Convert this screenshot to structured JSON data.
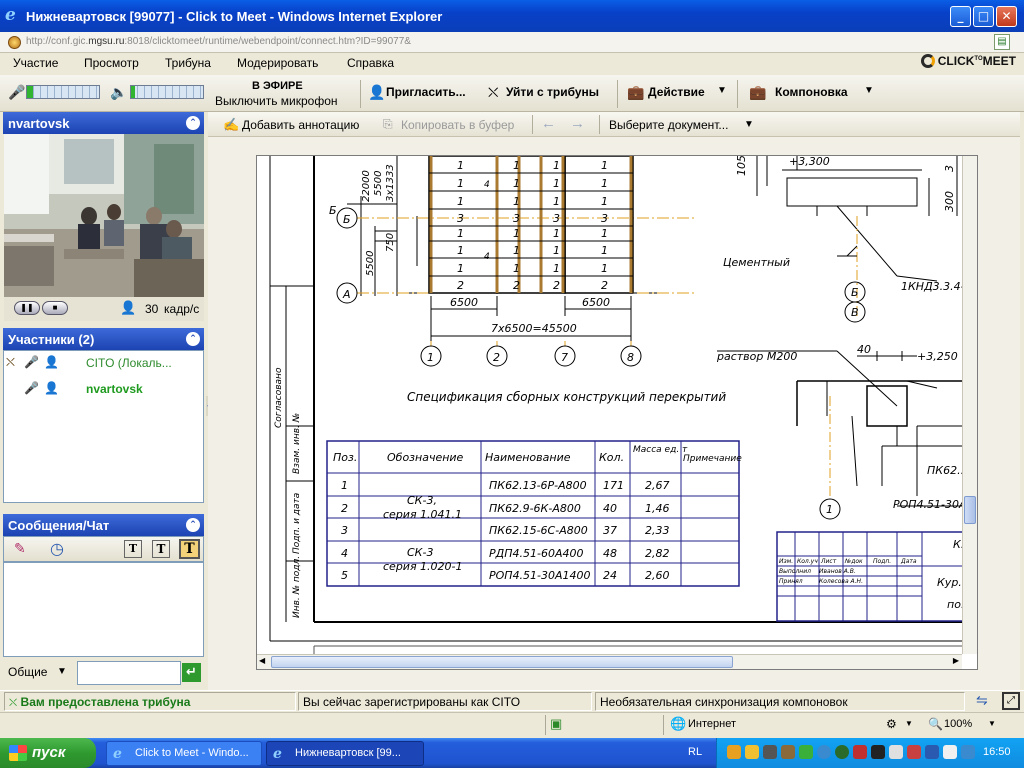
{
  "window": {
    "title": "Нижневартовск [99077] - Click to Meet - Windows Internet Explorer",
    "url_prefix": "http://conf.gic.",
    "url_domain": "mgsu.ru",
    "url_rest": ":8018/clicktomeet/runtime/webendpoint/connect.htm?ID=99077&"
  },
  "menu": [
    "Участие",
    "Просмотр",
    "Трибуна",
    "Модерировать",
    "Справка"
  ],
  "logo": {
    "text": "CLICK",
    "sup": "TO",
    "text2": "MEET"
  },
  "toolbar": {
    "on_air": "В ЭФИРЕ",
    "mic_off": "Выключить микрофон",
    "invite": "Пригласить...",
    "leave_tribune": "Уйти с трибуны",
    "action": "Действие",
    "layout": "Компоновка",
    "mic_level": 0.08,
    "speaker_level": 0.06
  },
  "video_panel": {
    "title": "nvartovsk",
    "fps_value": "30",
    "fps_unit": "кадр/с"
  },
  "participants_panel": {
    "title": "Участники (2)",
    "items": [
      {
        "name": "CITO (Локаль...",
        "color": "#2e8b2e"
      },
      {
        "name": "nvartovsk",
        "color": "#1e9a1e"
      }
    ]
  },
  "chat_panel": {
    "title": "Сообщения/Чат",
    "scope": "Общие"
  },
  "doc_toolbar": {
    "add_annotation": "Добавить аннотацию",
    "copy_to_buffer": "Копировать в буфер",
    "select_document": "Выберите документ..."
  },
  "drawing": {
    "dims_left": [
      "22000",
      "5500",
      "3х1333",
      "750",
      "5500"
    ],
    "axis_rows": [
      "Б",
      "А"
    ],
    "axis_cols": [
      "1",
      "2",
      "7",
      "8"
    ],
    "span1": "6500",
    "span2": "6500",
    "span_total": "7х6500=45500",
    "cell_values": [
      "1",
      "1",
      "1",
      "3",
      "1",
      "1",
      "1",
      "2"
    ],
    "mid_marks": [
      "4",
      "4"
    ],
    "right_labels": {
      "elev1": "+3,300",
      "dim1050": "1050",
      "dim300": "300",
      "dim3": "3",
      "mortar1": "Цементный",
      "mortar2": "раствор М200",
      "elev2": "+3,250",
      "dim40": "40",
      "axisB": "Б",
      "axisV": "В",
      "axis1": "1",
      "knd": "1КНД3.3.4-1",
      "pk62": "ПК62...",
      "rop": "РОП4.51-30А..."
    },
    "spec_title": "Спецификация сборных конструкций перекрытий",
    "side_stamp": [
      "Согласовано",
      "Взам. инв. №",
      "Подп. и дата",
      "Инв. № подл."
    ],
    "table": {
      "headers": [
        "Поз.",
        "Обозначение",
        "Наименование",
        "Кол.",
        "Масса ед. т",
        "Примечание"
      ],
      "rows": [
        [
          "1",
          "СК-3, серия 1.041.1",
          "ПК62.13-6Р-А800",
          "171",
          "2,67",
          ""
        ],
        [
          "2",
          "",
          "ПК62.9-6К-А800",
          "40",
          "1,46",
          ""
        ],
        [
          "3",
          "",
          "ПК62.15-6С-А800",
          "37",
          "2,33",
          ""
        ],
        [
          "4",
          "СК-3 серия 1.020-1",
          "РДП4.51-60А400",
          "48",
          "2,82",
          ""
        ],
        [
          "5",
          "",
          "РОП4.51-30А1400",
          "24",
          "2,60",
          ""
        ]
      ],
      "group1": [
        "СК-3,",
        "серия 1.041.1"
      ],
      "group2": [
        "СК-3",
        "серия 1.020-1"
      ]
    },
    "titleblock": {
      "headers": [
        "Изм.",
        "Кол.уч",
        "Лист",
        "№док",
        "Подп.",
        "Дата"
      ],
      "rows": [
        [
          "Выполнил",
          "Иванов А.В."
        ],
        [
          "Принял",
          "Колесова А.Н."
        ]
      ],
      "right1": "К...",
      "right2": "Кур...",
      "right3": "по..."
    }
  },
  "statusbar": {
    "tribune": "Вам предоставлена трибуна",
    "registered": "Вы сейчас зарегистрированы как CITO",
    "sync": "Необязательная синхронизация компоновок"
  },
  "ie_status": {
    "zone": "Интернет",
    "zoom": "100%"
  },
  "taskbar": {
    "start": "пуск",
    "tasks": [
      "Click to Meet - Windo...",
      "Нижневартовск [99..."
    ],
    "lang": "RL",
    "clock": "16:50"
  }
}
